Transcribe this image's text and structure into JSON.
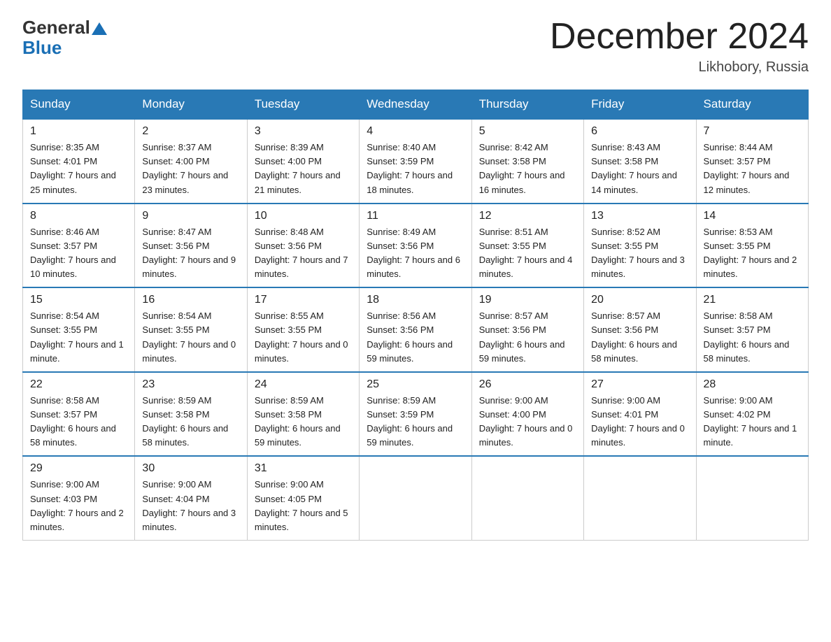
{
  "header": {
    "logo_general": "General",
    "logo_blue": "Blue",
    "month_title": "December 2024",
    "location": "Likhobory, Russia"
  },
  "days_of_week": [
    "Sunday",
    "Monday",
    "Tuesday",
    "Wednesday",
    "Thursday",
    "Friday",
    "Saturday"
  ],
  "weeks": [
    [
      {
        "day": "1",
        "sunrise": "8:35 AM",
        "sunset": "4:01 PM",
        "daylight": "7 hours and 25 minutes."
      },
      {
        "day": "2",
        "sunrise": "8:37 AM",
        "sunset": "4:00 PM",
        "daylight": "7 hours and 23 minutes."
      },
      {
        "day": "3",
        "sunrise": "8:39 AM",
        "sunset": "4:00 PM",
        "daylight": "7 hours and 21 minutes."
      },
      {
        "day": "4",
        "sunrise": "8:40 AM",
        "sunset": "3:59 PM",
        "daylight": "7 hours and 18 minutes."
      },
      {
        "day": "5",
        "sunrise": "8:42 AM",
        "sunset": "3:58 PM",
        "daylight": "7 hours and 16 minutes."
      },
      {
        "day": "6",
        "sunrise": "8:43 AM",
        "sunset": "3:58 PM",
        "daylight": "7 hours and 14 minutes."
      },
      {
        "day": "7",
        "sunrise": "8:44 AM",
        "sunset": "3:57 PM",
        "daylight": "7 hours and 12 minutes."
      }
    ],
    [
      {
        "day": "8",
        "sunrise": "8:46 AM",
        "sunset": "3:57 PM",
        "daylight": "7 hours and 10 minutes."
      },
      {
        "day": "9",
        "sunrise": "8:47 AM",
        "sunset": "3:56 PM",
        "daylight": "7 hours and 9 minutes."
      },
      {
        "day": "10",
        "sunrise": "8:48 AM",
        "sunset": "3:56 PM",
        "daylight": "7 hours and 7 minutes."
      },
      {
        "day": "11",
        "sunrise": "8:49 AM",
        "sunset": "3:56 PM",
        "daylight": "7 hours and 6 minutes."
      },
      {
        "day": "12",
        "sunrise": "8:51 AM",
        "sunset": "3:55 PM",
        "daylight": "7 hours and 4 minutes."
      },
      {
        "day": "13",
        "sunrise": "8:52 AM",
        "sunset": "3:55 PM",
        "daylight": "7 hours and 3 minutes."
      },
      {
        "day": "14",
        "sunrise": "8:53 AM",
        "sunset": "3:55 PM",
        "daylight": "7 hours and 2 minutes."
      }
    ],
    [
      {
        "day": "15",
        "sunrise": "8:54 AM",
        "sunset": "3:55 PM",
        "daylight": "7 hours and 1 minute."
      },
      {
        "day": "16",
        "sunrise": "8:54 AM",
        "sunset": "3:55 PM",
        "daylight": "7 hours and 0 minutes."
      },
      {
        "day": "17",
        "sunrise": "8:55 AM",
        "sunset": "3:55 PM",
        "daylight": "7 hours and 0 minutes."
      },
      {
        "day": "18",
        "sunrise": "8:56 AM",
        "sunset": "3:56 PM",
        "daylight": "6 hours and 59 minutes."
      },
      {
        "day": "19",
        "sunrise": "8:57 AM",
        "sunset": "3:56 PM",
        "daylight": "6 hours and 59 minutes."
      },
      {
        "day": "20",
        "sunrise": "8:57 AM",
        "sunset": "3:56 PM",
        "daylight": "6 hours and 58 minutes."
      },
      {
        "day": "21",
        "sunrise": "8:58 AM",
        "sunset": "3:57 PM",
        "daylight": "6 hours and 58 minutes."
      }
    ],
    [
      {
        "day": "22",
        "sunrise": "8:58 AM",
        "sunset": "3:57 PM",
        "daylight": "6 hours and 58 minutes."
      },
      {
        "day": "23",
        "sunrise": "8:59 AM",
        "sunset": "3:58 PM",
        "daylight": "6 hours and 58 minutes."
      },
      {
        "day": "24",
        "sunrise": "8:59 AM",
        "sunset": "3:58 PM",
        "daylight": "6 hours and 59 minutes."
      },
      {
        "day": "25",
        "sunrise": "8:59 AM",
        "sunset": "3:59 PM",
        "daylight": "6 hours and 59 minutes."
      },
      {
        "day": "26",
        "sunrise": "9:00 AM",
        "sunset": "4:00 PM",
        "daylight": "7 hours and 0 minutes."
      },
      {
        "day": "27",
        "sunrise": "9:00 AM",
        "sunset": "4:01 PM",
        "daylight": "7 hours and 0 minutes."
      },
      {
        "day": "28",
        "sunrise": "9:00 AM",
        "sunset": "4:02 PM",
        "daylight": "7 hours and 1 minute."
      }
    ],
    [
      {
        "day": "29",
        "sunrise": "9:00 AM",
        "sunset": "4:03 PM",
        "daylight": "7 hours and 2 minutes."
      },
      {
        "day": "30",
        "sunrise": "9:00 AM",
        "sunset": "4:04 PM",
        "daylight": "7 hours and 3 minutes."
      },
      {
        "day": "31",
        "sunrise": "9:00 AM",
        "sunset": "4:05 PM",
        "daylight": "7 hours and 5 minutes."
      },
      null,
      null,
      null,
      null
    ]
  ],
  "labels": {
    "sunrise": "Sunrise:",
    "sunset": "Sunset:",
    "daylight": "Daylight:"
  }
}
